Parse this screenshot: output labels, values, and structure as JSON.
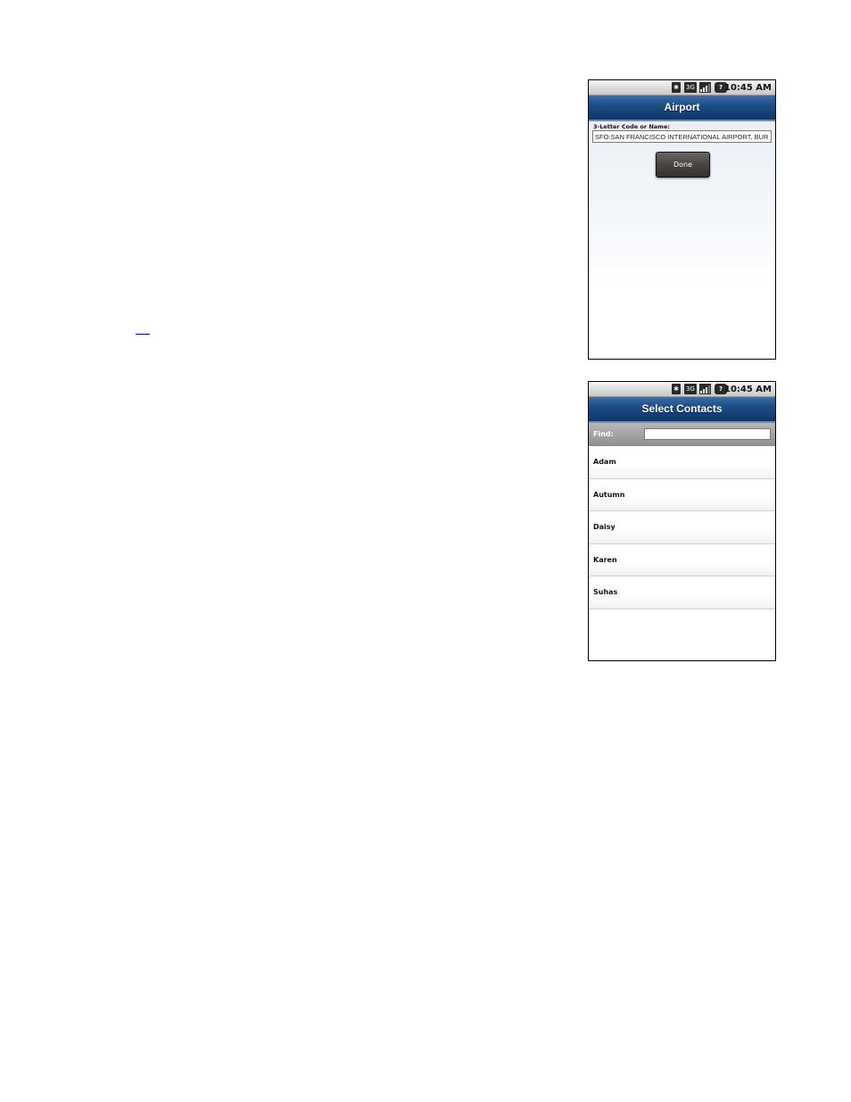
{
  "status_bar": {
    "time": "10:45 AM",
    "icons": [
      "bluetooth-icon",
      "3g-icon",
      "signal-icon",
      "help-icon"
    ],
    "threeg_label": "3G",
    "help_label": "?"
  },
  "airport_screen": {
    "title": "Airport",
    "field_label": "3-Letter Code or Name:",
    "field_value": "SFO:SAN FRANCISCO INTERNATIONAL AIRPORT, BUR",
    "done_label": "Done"
  },
  "contacts_screen": {
    "title": "Select Contacts",
    "find_label": "Find:",
    "find_value": "",
    "contacts": [
      "Adam",
      "Autumn",
      "Daisy",
      "Karen",
      "Suhas"
    ]
  },
  "colors": {
    "titlebar": "#1d4d86",
    "link": "#0000ee",
    "button": "#4a4745"
  }
}
